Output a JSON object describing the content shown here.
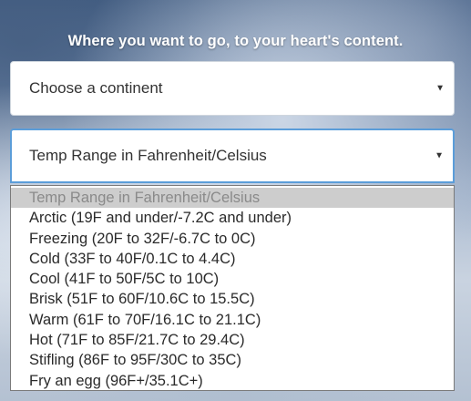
{
  "header": {
    "tagline": "Where you want to go, to your heart's content."
  },
  "continent_select": {
    "value": "Choose a continent"
  },
  "temp_select": {
    "value": "Temp Range in Fahrenheit/Celsius",
    "options": [
      {
        "label": "Temp Range in Fahrenheit/Celsius",
        "selected": true
      },
      {
        "label": "Arctic (19F and under/-7.2C and under)"
      },
      {
        "label": "Freezing (20F to 32F/-6.7C to 0C)"
      },
      {
        "label": "Cold (33F to 40F/0.1C to 4.4C)"
      },
      {
        "label": "Cool (41F to 50F/5C to 10C)"
      },
      {
        "label": "Brisk (51F to 60F/10.6C to 15.5C)"
      },
      {
        "label": "Warm (61F to 70F/16.1C to 21.1C)"
      },
      {
        "label": "Hot (71F to 85F/21.7C to 29.4C)"
      },
      {
        "label": "Stifling (86F to 95F/30C to 35C)"
      },
      {
        "label": "Fry an egg (96F+/35.1C+)"
      }
    ]
  },
  "icons": {
    "dropdown_arrow": "chevron-down-icon"
  },
  "colors": {
    "focus_border": "#5b9dd9",
    "highlight_option": "#cdcdcd",
    "tagline_text": "#ffffff"
  }
}
